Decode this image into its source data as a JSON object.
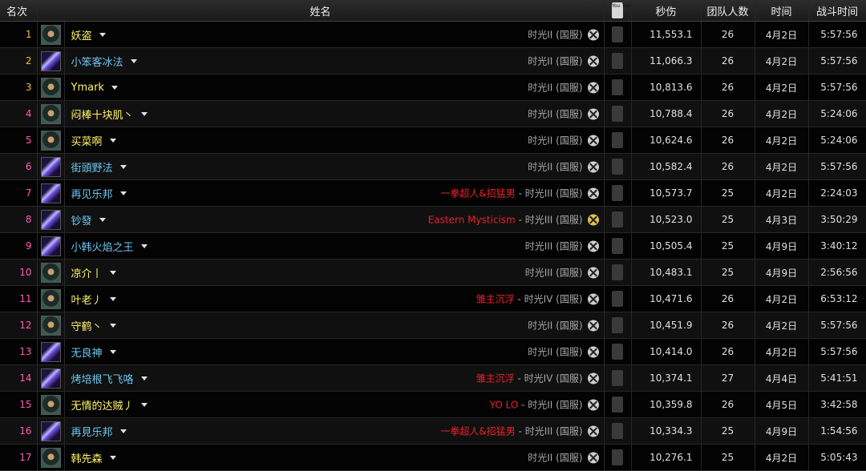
{
  "headers": {
    "rank": "名次",
    "name": "姓名",
    "youtube": "You Tube",
    "dps": "秒伤",
    "raid_size": "团队人数",
    "date": "时间",
    "duration": "战斗时间"
  },
  "icons": {
    "rogue": "rogue-class-icon",
    "mage": "mage-class-icon",
    "faction": "faction-crossed-swords-icon",
    "video": "youtube-icon",
    "dropdown": "chevron-down-icon"
  },
  "colors": {
    "rank_gold": "#e7c13a",
    "rank_pink": "#ff5ab4",
    "rogue_name": "#fff468",
    "mage_name": "#6cc6f0",
    "guild": "#e8222a"
  },
  "rows": [
    {
      "rank": "1",
      "name": "妖盗",
      "cls": "rogue",
      "guild": "",
      "server": "时光II (国服)",
      "dps": "11,553.1",
      "size": "26",
      "date": "4月2日",
      "duration": "5:57:56"
    },
    {
      "rank": "2",
      "name": "小笨客冰法",
      "cls": "mage",
      "guild": "",
      "server": "时光II (国服)",
      "dps": "11,066.3",
      "size": "26",
      "date": "4月2日",
      "duration": "5:57:56"
    },
    {
      "rank": "3",
      "name": "Ymark",
      "cls": "rogue",
      "guild": "",
      "server": "时光II (国服)",
      "dps": "10,813.6",
      "size": "26",
      "date": "4月2日",
      "duration": "5:57:56"
    },
    {
      "rank": "4",
      "name": "闷棒十块肌丶",
      "cls": "rogue",
      "guild": "",
      "server": "时光II (国服)",
      "dps": "10,788.4",
      "size": "26",
      "date": "4月2日",
      "duration": "5:24:06"
    },
    {
      "rank": "5",
      "name": "买菜啊",
      "cls": "rogue",
      "guild": "",
      "server": "时光II (国服)",
      "dps": "10,624.6",
      "size": "26",
      "date": "4月2日",
      "duration": "5:24:06"
    },
    {
      "rank": "6",
      "name": "街頭野法",
      "cls": "mage",
      "guild": "",
      "server": "时光II (国服)",
      "dps": "10,582.4",
      "size": "26",
      "date": "4月2日",
      "duration": "5:57:56"
    },
    {
      "rank": "7",
      "name": "再见乐邦",
      "cls": "mage",
      "guild": "一拳超人&招猛男",
      "server": "时光III (国服)",
      "dps": "10,573.7",
      "size": "25",
      "date": "4月2日",
      "duration": "2:24:03"
    },
    {
      "rank": "8",
      "name": "钞發",
      "cls": "mage",
      "guild": "Eastern Mysticism",
      "server": "时光III (国服)",
      "dps": "10,523.0",
      "size": "25",
      "date": "4月3日",
      "duration": "3:50:29",
      "gold": true
    },
    {
      "rank": "9",
      "name": "小韩火焰之王",
      "cls": "mage",
      "guild": "",
      "server": "时光III (国服)",
      "dps": "10,505.4",
      "size": "25",
      "date": "4月9日",
      "duration": "3:40:12"
    },
    {
      "rank": "10",
      "name": "凉介丨",
      "cls": "rogue",
      "guild": "",
      "server": "时光III (国服)",
      "dps": "10,483.1",
      "size": "25",
      "date": "4月9日",
      "duration": "2:56:56"
    },
    {
      "rank": "11",
      "name": "叶老丿",
      "cls": "rogue",
      "guild": "雏主沉浮",
      "server": "时光IV (国服)",
      "dps": "10,471.6",
      "size": "26",
      "date": "4月2日",
      "duration": "6:53:12"
    },
    {
      "rank": "12",
      "name": "守鹤丶",
      "cls": "rogue",
      "guild": "",
      "server": "时光II (国服)",
      "dps": "10,451.9",
      "size": "26",
      "date": "4月2日",
      "duration": "5:57:56"
    },
    {
      "rank": "13",
      "name": "无良神",
      "cls": "mage",
      "guild": "",
      "server": "时光II (国服)",
      "dps": "10,414.0",
      "size": "26",
      "date": "4月2日",
      "duration": "5:57:56"
    },
    {
      "rank": "14",
      "name": "烤培根飞飞咯",
      "cls": "mage",
      "guild": "雏主沉浮",
      "server": "时光IV (国服)",
      "dps": "10,374.1",
      "size": "27",
      "date": "4月4日",
      "duration": "5:41:51"
    },
    {
      "rank": "15",
      "name": "无情的达贼丿",
      "cls": "rogue",
      "guild": "YO LO",
      "server": "时光II (国服)",
      "dps": "10,359.8",
      "size": "26",
      "date": "4月5日",
      "duration": "3:42:58"
    },
    {
      "rank": "16",
      "name": "再見乐邦",
      "cls": "mage",
      "guild": "一拳超人&招猛男",
      "server": "时光III (国服)",
      "dps": "10,334.3",
      "size": "25",
      "date": "4月9日",
      "duration": "1:54:56"
    },
    {
      "rank": "17",
      "name": "韩先森",
      "cls": "rogue",
      "guild": "",
      "server": "时光II (国服)",
      "dps": "10,276.1",
      "size": "25",
      "date": "4月2日",
      "duration": "5:05:43"
    }
  ]
}
